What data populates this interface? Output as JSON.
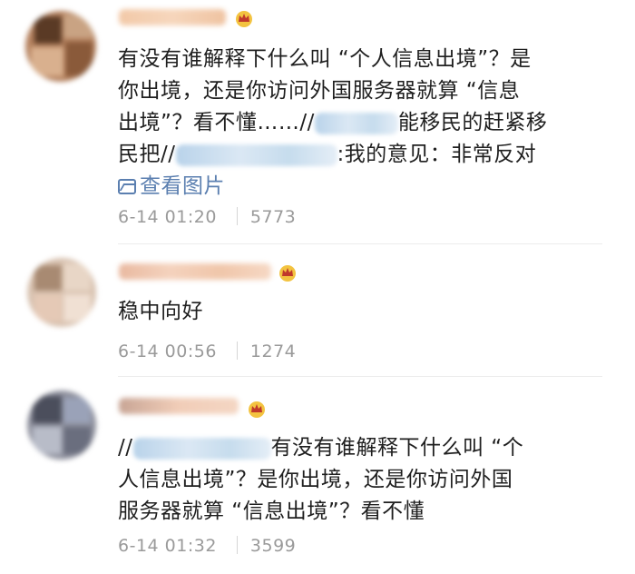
{
  "comments": [
    {
      "lines": [
        "有没有谁解释下什么叫 “个人信息出境”？是",
        "你出境，还是你访问外国服务器就算 “信息",
        "出境”？看不懂……//",
        "能移民的赶紧移",
        "民把//",
        ":我的意见：非常反对"
      ],
      "view_images": "查看图片",
      "time": "6-14 01:20",
      "likes": "5773"
    },
    {
      "lines": [
        "稳中向好"
      ],
      "time": "6-14 00:56",
      "likes": "1274"
    },
    {
      "lines": [
        "//",
        "有没有谁解释下什么叫 “个",
        "人信息出境”？是你出境，还是你访问外国",
        "服务器就算 “信息出境”？看不懂"
      ],
      "time": "6-14 01:32",
      "likes": "3599"
    }
  ],
  "colors": {
    "link": "#5b7fb0",
    "meta": "#9a9a9a",
    "crown": "#e8a21a"
  },
  "icons": {
    "view_images": "image-icon",
    "badge": "crown-badge-icon"
  }
}
